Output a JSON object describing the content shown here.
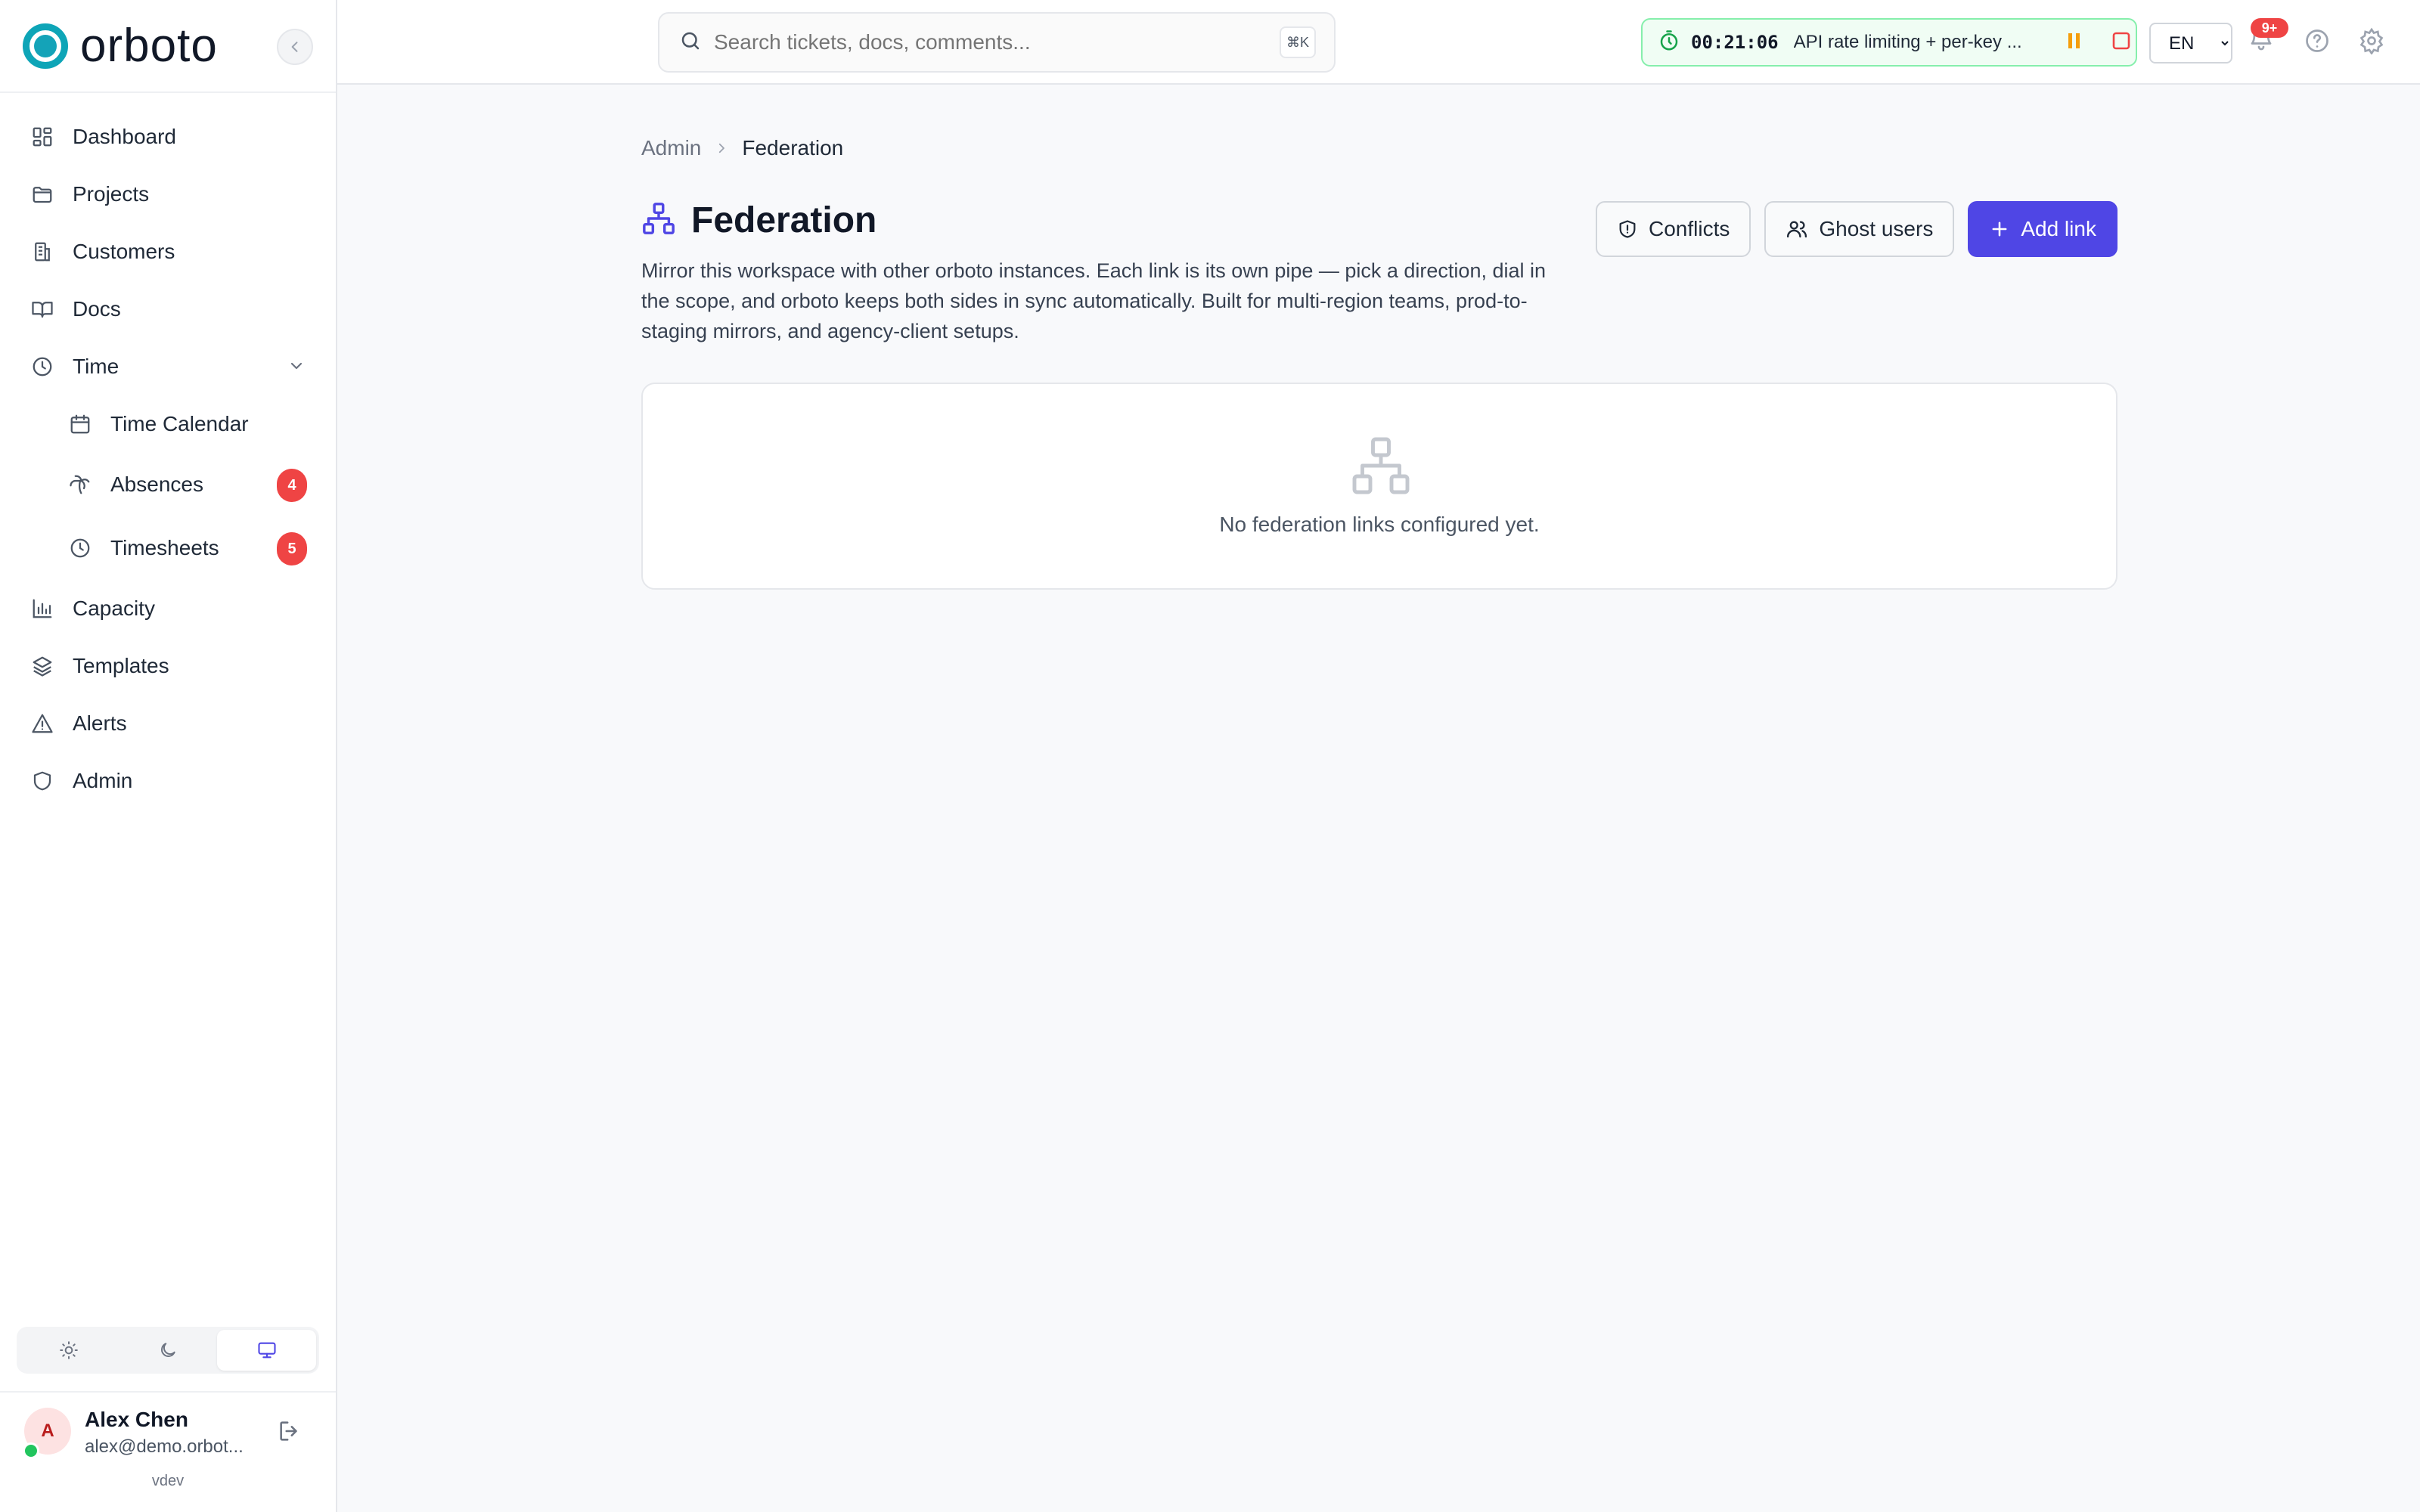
{
  "app": {
    "name": "orboto",
    "version": "vdev"
  },
  "sidebar": {
    "items": [
      {
        "label": "Dashboard",
        "icon": "dashboard-icon"
      },
      {
        "label": "Projects",
        "icon": "folder-icon"
      },
      {
        "label": "Customers",
        "icon": "building-icon"
      },
      {
        "label": "Docs",
        "icon": "book-icon"
      },
      {
        "label": "Time",
        "icon": "clock-icon",
        "expanded": true
      },
      {
        "label": "Time Calendar",
        "icon": "calendar-icon"
      },
      {
        "label": "Absences",
        "icon": "palm-tree-icon",
        "badge": "4"
      },
      {
        "label": "Timesheets",
        "icon": "clock-icon",
        "badge": "5"
      },
      {
        "label": "Capacity",
        "icon": "bar-chart-icon"
      },
      {
        "label": "Templates",
        "icon": "layers-icon"
      },
      {
        "label": "Alerts",
        "icon": "alert-triangle-icon"
      },
      {
        "label": "Admin",
        "icon": "shield-icon"
      }
    ],
    "theme_active": "system"
  },
  "user": {
    "initial": "A",
    "name": "Alex Chen",
    "email": "alex@demo.orbot..."
  },
  "topbar": {
    "search_placeholder": "Search tickets, docs, comments...",
    "search_shortcut": "⌘K",
    "timer_time": "00:21:06",
    "timer_task": "API rate limiting + per-key ...",
    "language": "EN",
    "notifications": "9+"
  },
  "breadcrumb": {
    "parent": "Admin",
    "current": "Federation"
  },
  "page": {
    "title": "Federation",
    "description": "Mirror this workspace with other orboto instances. Each link is its own pipe — pick a direction, dial in the scope, and orboto keeps both sides in sync automatically. Built for multi-region teams, prod-to-staging mirrors, and agency-client setups.",
    "buttons": {
      "conflicts": "Conflicts",
      "ghost_users": "Ghost users",
      "add_link": "Add link"
    },
    "empty_state": "No federation links configured yet."
  },
  "colors": {
    "accent": "#4f46e5",
    "brand": "#0ea5b7",
    "badge": "#ef4444",
    "timer": "#22c55e"
  }
}
